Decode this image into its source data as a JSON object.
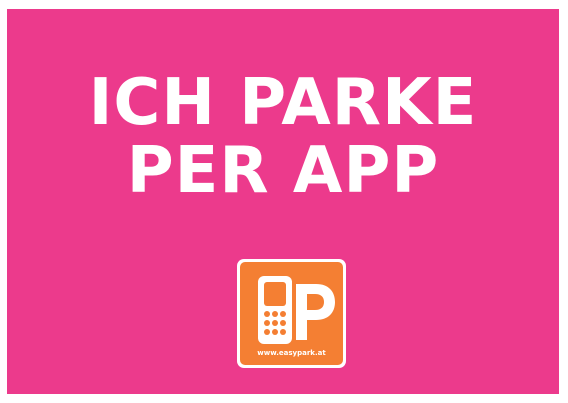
{
  "sign": {
    "headline_line1": "ICH PARKE",
    "headline_line2": "PER APP",
    "background_color": "#ec3a8c"
  },
  "logo": {
    "icon": "phone-parking-p-icon",
    "url_text": "www.easypark.at",
    "color": "#f47f33"
  }
}
